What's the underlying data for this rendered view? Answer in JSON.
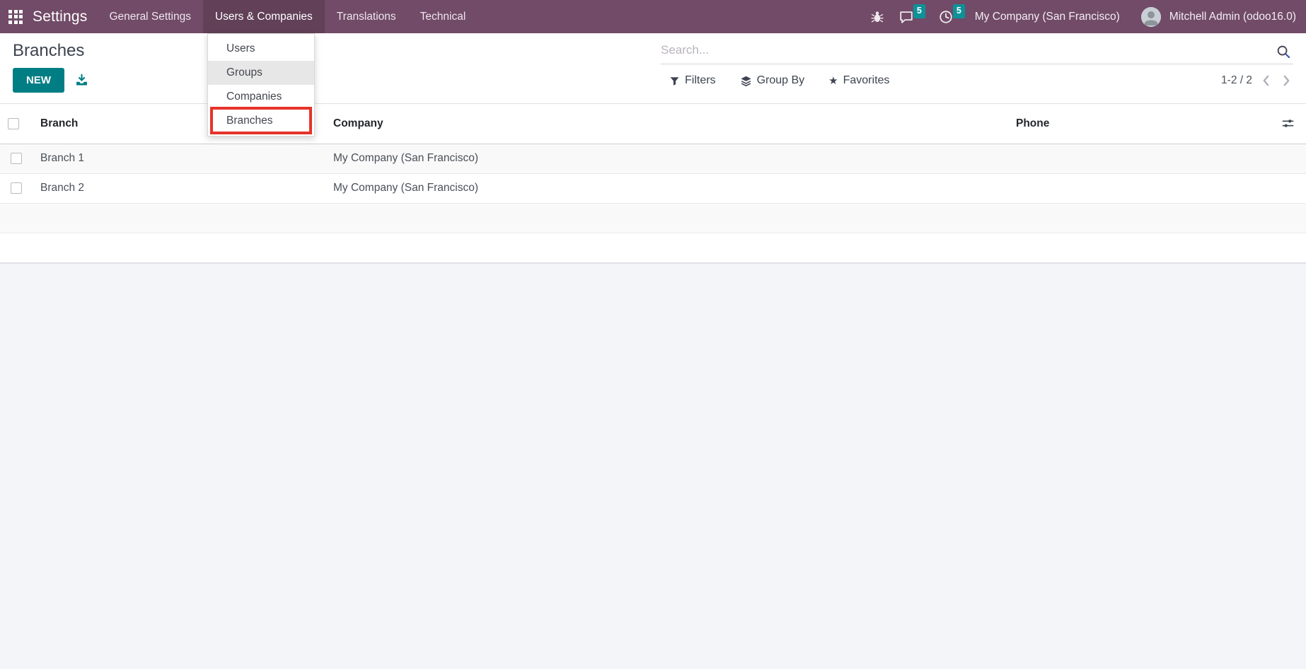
{
  "navbar": {
    "app_name": "Settings",
    "menu": [
      {
        "label": "General Settings"
      },
      {
        "label": "Users & Companies"
      },
      {
        "label": "Translations"
      },
      {
        "label": "Technical"
      }
    ],
    "systray": {
      "message_badge": "5",
      "activity_badge": "5",
      "company": "My Company (San Francisco)",
      "user": "Mitchell Admin (odoo16.0)"
    }
  },
  "dropdown": {
    "items": [
      {
        "label": "Users"
      },
      {
        "label": "Groups"
      },
      {
        "label": "Companies"
      },
      {
        "label": "Branches"
      }
    ]
  },
  "control_panel": {
    "title": "Branches",
    "new_button": "NEW",
    "search_placeholder": "Search...",
    "filters": "Filters",
    "group_by": "Group By",
    "favorites": "Favorites",
    "pager_value": "1-2 / 2"
  },
  "table": {
    "headers": {
      "branch": "Branch",
      "company": "Company",
      "phone": "Phone"
    },
    "rows": [
      {
        "branch": "Branch 1",
        "company": "My Company (San Francisco)",
        "phone": ""
      },
      {
        "branch": "Branch 2",
        "company": "My Company (San Francisco)",
        "phone": ""
      }
    ]
  },
  "colors": {
    "navbar_bg": "#714b67",
    "primary_button": "#017e84",
    "badge": "#0c9299",
    "highlight_outline": "#e6332a",
    "hovered_menu_item": "#e7e7e7",
    "content_bg": "#f4f5f9"
  }
}
